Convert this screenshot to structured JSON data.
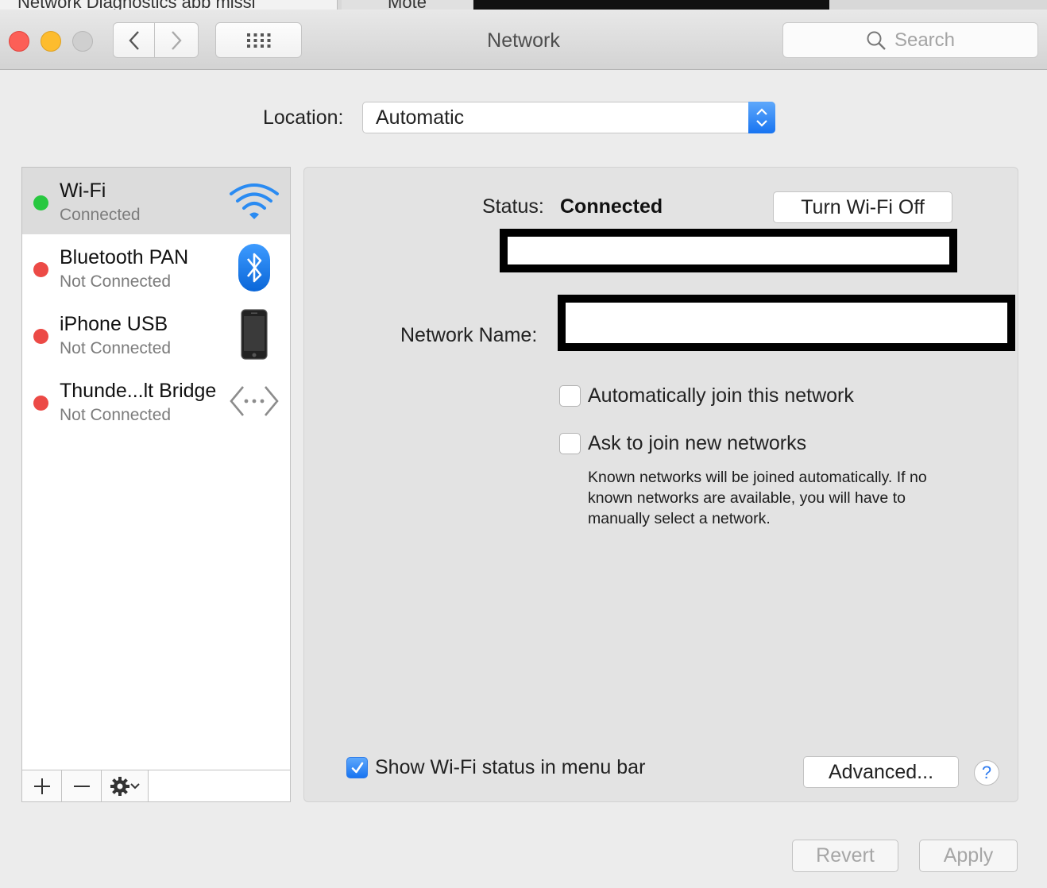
{
  "browser_tabs": {
    "tab1": "Network Diagnostics abb missi",
    "tab2": "Mote"
  },
  "window": {
    "title": "Network",
    "search_placeholder": "Search"
  },
  "location": {
    "label": "Location:",
    "value": "Automatic"
  },
  "services": [
    {
      "name": "Wi-Fi",
      "status": "Connected",
      "status_color": "#28c840",
      "icon": "wifi-icon"
    },
    {
      "name": "Bluetooth PAN",
      "status": "Not Connected",
      "status_color": "#ec4a46",
      "icon": "bluetooth-icon"
    },
    {
      "name": "iPhone USB",
      "status": "Not Connected",
      "status_color": "#ec4a46",
      "icon": "iphone-icon"
    },
    {
      "name": "Thunde...lt Bridge",
      "status": "Not Connected",
      "status_color": "#ec4a46",
      "icon": "thunderbolt-bridge-icon"
    }
  ],
  "detail": {
    "status_label": "Status:",
    "status_value": "Connected",
    "turn_off_label": "Turn Wi-Fi Off",
    "network_name_label": "Network Name:",
    "auto_join_label": "Automatically join this network",
    "ask_join_label": "Ask to join new networks",
    "help_text": "Known networks will be joined automatically. If no known networks are available, you will have to manually select a network.",
    "show_status_label": "Show Wi-Fi status in menu bar",
    "show_status_checked": true,
    "advanced_label": "Advanced...",
    "help_label": "?"
  },
  "footer": {
    "revert_label": "Revert",
    "apply_label": "Apply"
  },
  "colors": {
    "accent": "#1874f1",
    "connected": "#28c840",
    "disconnected": "#ec4a46"
  }
}
